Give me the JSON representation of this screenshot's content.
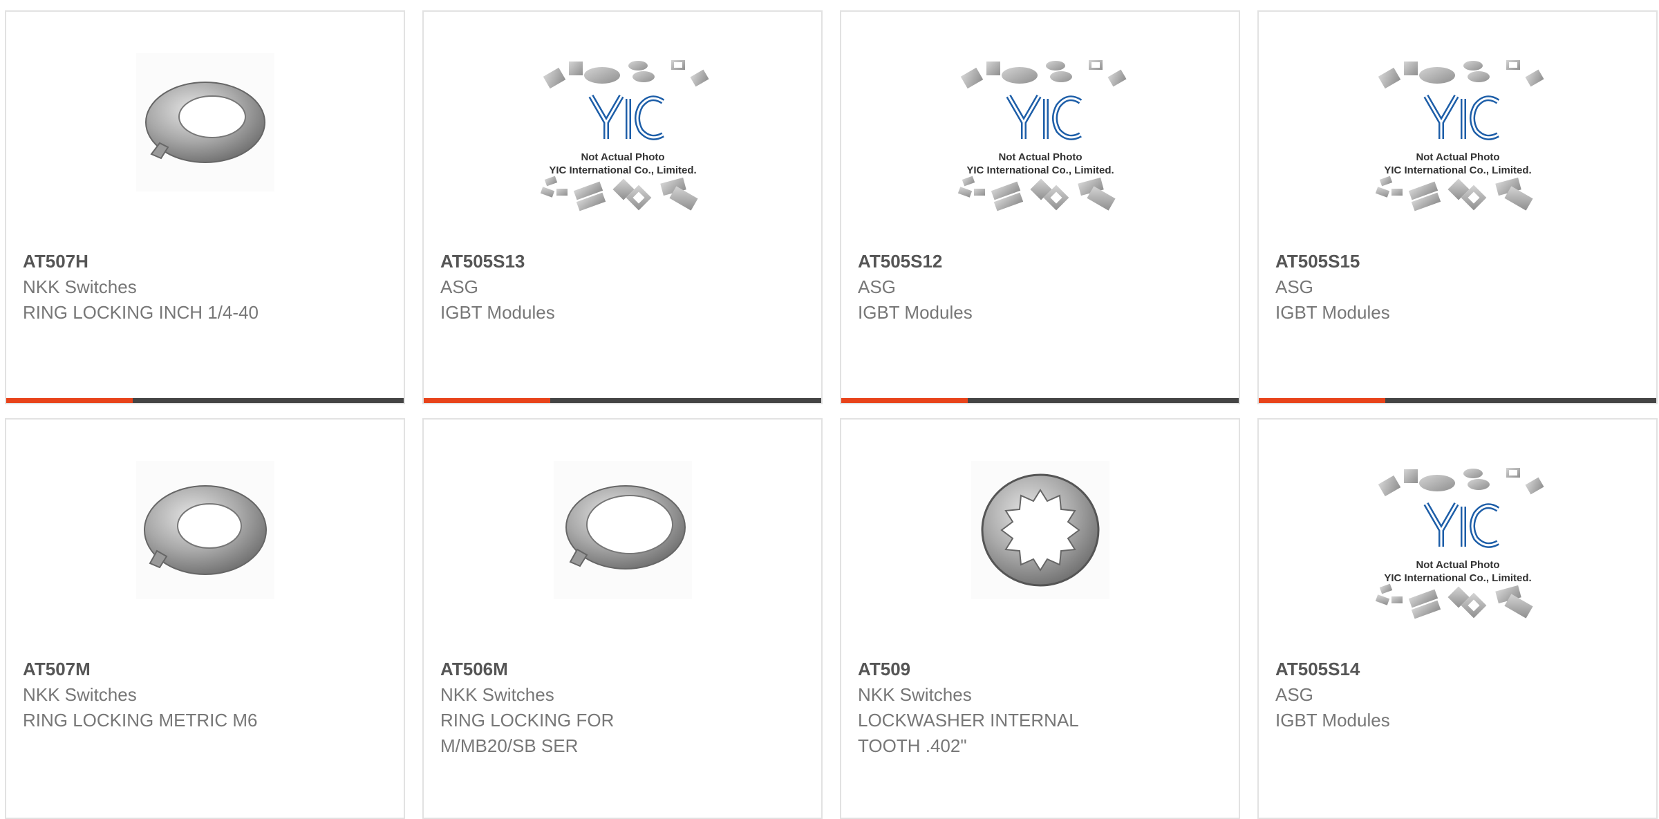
{
  "colors": {
    "accent": "#e8431a",
    "bar": "#444444",
    "text_primary": "#555555",
    "text_secondary": "#777777"
  },
  "placeholder_logo": {
    "brand": "YIC",
    "line1": "Not Actual Photo",
    "line2": "YIC International Co., Limited."
  },
  "cards": [
    {
      "part": "AT507H",
      "manufacturer": "NKK Switches",
      "description": "RING LOCKING INCH 1/4-40",
      "image": "lock-washer-split"
    },
    {
      "part": "AT505S13",
      "manufacturer": "ASG",
      "description": "IGBT Modules",
      "image": "yic-placeholder"
    },
    {
      "part": "AT505S12",
      "manufacturer": "ASG",
      "description": "IGBT Modules",
      "image": "yic-placeholder"
    },
    {
      "part": "AT505S15",
      "manufacturer": "ASG",
      "description": "IGBT Modules",
      "image": "yic-placeholder"
    },
    {
      "part": "AT507M",
      "manufacturer": "NKK Switches",
      "description": "RING LOCKING METRIC M6",
      "image": "lock-washer-split"
    },
    {
      "part": "AT506M",
      "manufacturer": "NKK Switches",
      "description": "RING LOCKING FOR M/MB20/SB SER",
      "image": "lock-washer-thin"
    },
    {
      "part": "AT509",
      "manufacturer": "NKK Switches",
      "description": "LOCKWASHER INTERNAL TOOTH .402\"",
      "image": "internal-tooth-washer"
    },
    {
      "part": "AT505S14",
      "manufacturer": "ASG",
      "description": "IGBT Modules",
      "image": "yic-placeholder"
    }
  ]
}
